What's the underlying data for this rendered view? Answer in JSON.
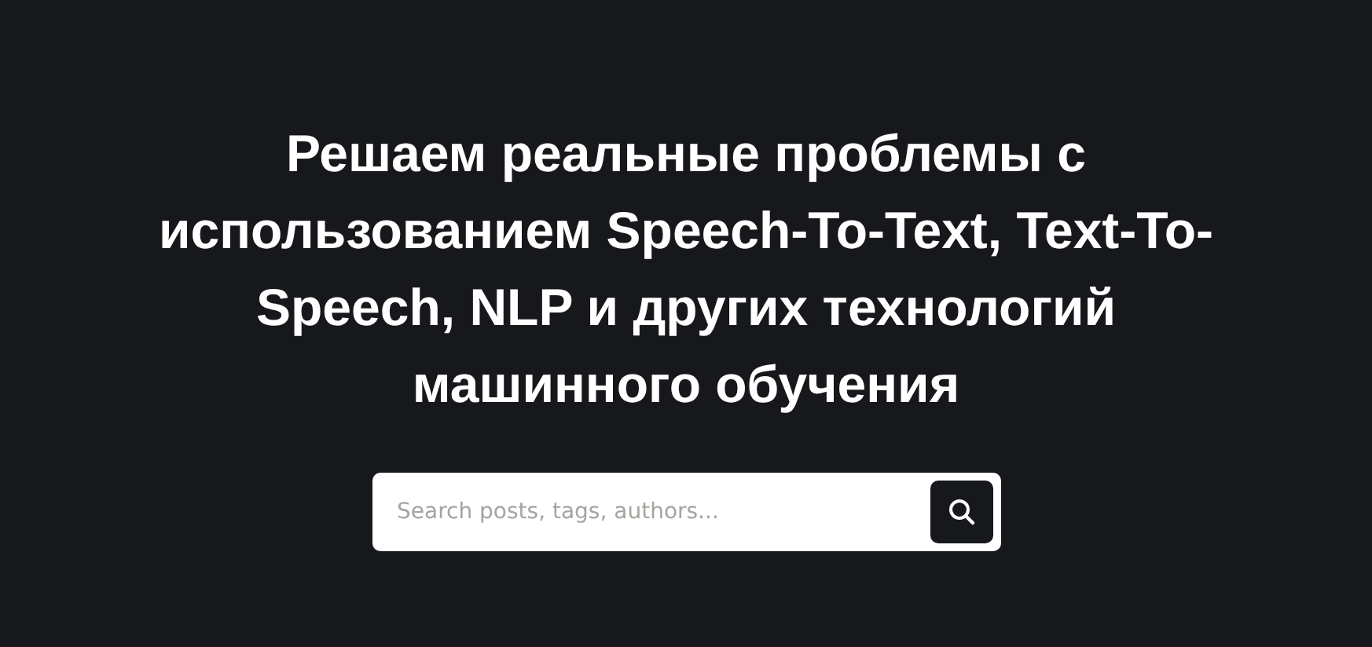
{
  "hero": {
    "title": "Решаем реальные проблемы с использованием Speech-To-Text, Text-To-Speech, NLP и других технологий машинного обучения"
  },
  "search": {
    "placeholder": "Search posts, tags, authors..."
  }
}
